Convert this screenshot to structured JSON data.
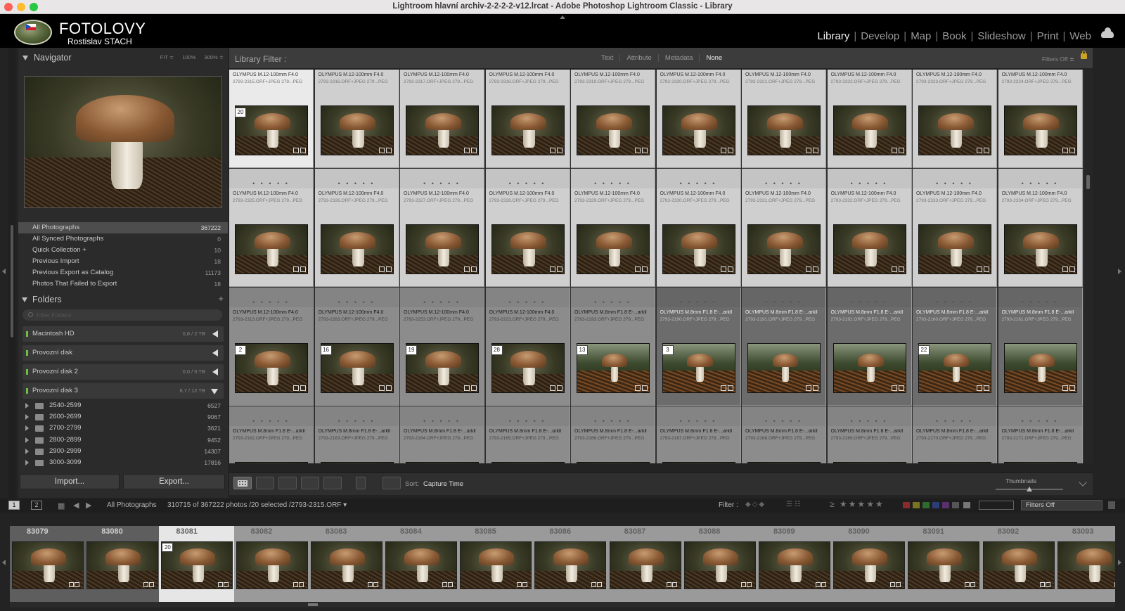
{
  "window": {
    "title": "Lightroom hlavní archiv-2-2-2-2-v12.lrcat - Adobe Photoshop Lightroom Classic - Library"
  },
  "identity": {
    "brand": "FOTOLOVY",
    "subtitle": "Rostislav STACH"
  },
  "modules": [
    "Library",
    "Develop",
    "Map",
    "Book",
    "Slideshow",
    "Print",
    "Web"
  ],
  "active_module": "Library",
  "navigator": {
    "title": "Navigator",
    "options": [
      "FIT ≑",
      "100%",
      "300% ≑"
    ]
  },
  "catalog": [
    {
      "label": "All Photographs",
      "count": "367222",
      "selected": true
    },
    {
      "label": "All Synced Photographs",
      "count": "0"
    },
    {
      "label": "Quick Collection  +",
      "count": "10"
    },
    {
      "label": "Previous Import",
      "count": "18"
    },
    {
      "label": "Previous Export as Catalog",
      "count": "11173"
    },
    {
      "label": "Photos That Failed to Export",
      "count": "18"
    }
  ],
  "folders": {
    "title": "Folders",
    "filter_placeholder": "Filter Folders",
    "volumes": [
      {
        "name": "Macintosh HD",
        "capacity": "0,8 / 2 TB"
      },
      {
        "name": "Provozní disk",
        "capacity": ""
      },
      {
        "name": "Provozní disk 2",
        "capacity": "0,0 / 5 TB"
      },
      {
        "name": "Provozní disk 3",
        "capacity": "6,7 / 12 TB"
      }
    ],
    "items": [
      {
        "name": "2540-2599",
        "count": "6527"
      },
      {
        "name": "2600-2699",
        "count": "9067"
      },
      {
        "name": "2700-2799",
        "count": "3621"
      },
      {
        "name": "2800-2899",
        "count": "9452"
      },
      {
        "name": "2900-2999",
        "count": "14307"
      },
      {
        "name": "3000-3099",
        "count": "17816"
      }
    ]
  },
  "buttons": {
    "import": "Import...",
    "export": "Export..."
  },
  "library_filter": {
    "label": "Library Filter :",
    "tabs": [
      "Text",
      "Attribute",
      "Metadata",
      "None"
    ],
    "active": "None",
    "filters_off": "Filters Off ≑"
  },
  "grid": {
    "rows": [
      {
        "cells": [
          {
            "l1": "OLYMPUS M.12-100mm F4.0",
            "l2": "2793-2315.ORF+JPEG    279...PEG",
            "vc": "20",
            "state": "sel"
          },
          {
            "l1": "OLYMPUS M.12-100mm F4.0",
            "l2": "2793-2316.ORF+JPEG    279...PEG"
          },
          {
            "l1": "OLYMPUS M.12-100mm F4.0",
            "l2": "2793-2317.ORF+JPEG    279...PEG"
          },
          {
            "l1": "OLYMPUS M.12-100mm F4.0",
            "l2": "2793-2318.ORF+JPEG    279...PEG"
          },
          {
            "l1": "OLYMPUS M.12-100mm F4.0",
            "l2": "2793-2319.ORF+JPEG    279...PEG"
          },
          {
            "l1": "OLYMPUS M.12-100mm F4.0",
            "l2": "2793-2320.ORF+JPEG    279...PEG"
          },
          {
            "l1": "OLYMPUS M.12-100mm F4.0",
            "l2": "2793-2321.ORF+JPEG    279...PEG"
          },
          {
            "l1": "OLYMPUS M.12-100mm F4.0",
            "l2": "2793-2322.ORF+JPEG    279...PEG"
          },
          {
            "l1": "OLYMPUS M.12-100mm F4.0",
            "l2": "2793-2323.ORF+JPEG    279...PEG"
          },
          {
            "l1": "OLYMPUS M.12-100mm F4.0",
            "l2": "2793-2324.ORF+JPEG    279...PEG"
          }
        ]
      },
      {
        "cells": [
          {
            "l1": "OLYMPUS M.12-100mm F4.0",
            "l2": "2793-2325.ORF+JPEG    279...PEG"
          },
          {
            "l1": "OLYMPUS M.12-100mm F4.0",
            "l2": "2793-2326.ORF+JPEG    279...PEG"
          },
          {
            "l1": "OLYMPUS M.12-100mm F4.0",
            "l2": "2793-2327.ORF+JPEG    279...PEG"
          },
          {
            "l1": "OLYMPUS M.12-100mm F4.0",
            "l2": "2793-2328.ORF+JPEG    279...PEG"
          },
          {
            "l1": "OLYMPUS M.12-100mm F4.0",
            "l2": "2793-2329.ORF+JPEG    279...PEG"
          },
          {
            "l1": "OLYMPUS M.12-100mm F4.0",
            "l2": "2793-2330.ORF+JPEG    279...PEG"
          },
          {
            "l1": "OLYMPUS M.12-100mm F4.0",
            "l2": "2793-2331.ORF+JPEG    279...PEG"
          },
          {
            "l1": "OLYMPUS M.12-100mm F4.0",
            "l2": "2793-2332.ORF+JPEG    279...PEG"
          },
          {
            "l1": "OLYMPUS M.12-100mm F4.0",
            "l2": "2793-2333.ORF+JPEG    279...PEG"
          },
          {
            "l1": "OLYMPUS M.12-100mm F4.0",
            "l2": "2793-2334.ORF+JPEG    279...PEG"
          }
        ]
      },
      {
        "cells": [
          {
            "l1": "OLYMPUS M.12-100mm F4.0",
            "l2": "2793-2313.ORF+JPEG    279...PEG",
            "vc": "2",
            "state": "dim"
          },
          {
            "l1": "OLYMPUS M.12-100mm F4.0",
            "l2": "2793-2283.ORF+JPEG    279...PEG",
            "vc": "16",
            "state": "dim"
          },
          {
            "l1": "OLYMPUS M.12-100mm F4.0",
            "l2": "2793-2253.ORF+JPEG    279...PEG",
            "vc": "19",
            "state": "dim"
          },
          {
            "l1": "OLYMPUS M.12-100mm F4.0",
            "l2": "2793-2223.ORF+JPEG    279...PEG",
            "vc": "28",
            "state": "dim"
          },
          {
            "l1": "OLYMPUS M.8mm F1.8    E-...arkll",
            "l2": "2793-2193.ORF+JPEG    279...PEG",
            "vc": "13",
            "state": "dim",
            "wide": true
          },
          {
            "l1": "OLYMPUS M.8mm F1.8    E-...arkll",
            "l2": "2793-2190.ORF+JPEG    279...PEG",
            "vc": "3",
            "state": "dark",
            "wide": true
          },
          {
            "l1": "OLYMPUS M.8mm F1.8    E-...arkll",
            "l2": "2793-2191.ORF+JPEG    279...PEG",
            "state": "dark",
            "wide": true
          },
          {
            "l1": "OLYMPUS M.8mm F1.8    E-...arkll",
            "l2": "2793-2192.ORF+JPEG    279...PEG",
            "state": "dark",
            "wide": true
          },
          {
            "l1": "OLYMPUS M.8mm F1.8    E-...arkll",
            "l2": "2793-2160.ORF+JPEG    279...PEG",
            "vc": "22",
            "state": "dark",
            "wide": true
          },
          {
            "l1": "OLYMPUS M.8mm F1.8    E-...arkll",
            "l2": "2793-2161.ORF+JPEG    279...PEG",
            "state": "dark",
            "wide": true
          }
        ]
      },
      {
        "cells": [
          {
            "l1": "OLYMPUS M.8mm F1.8    E-...arkll",
            "l2": "2793-2162.ORF+JPEG    279...PEG",
            "state": "dim"
          },
          {
            "l1": "OLYMPUS M.8mm F1.8    E-...arkll",
            "l2": "2793-2163.ORF+JPEG    279...PEG",
            "state": "dim"
          },
          {
            "l1": "OLYMPUS M.8mm F1.8    E-...arkll",
            "l2": "2793-2164.ORF+JPEG    279...PEG",
            "state": "dim"
          },
          {
            "l1": "OLYMPUS M.8mm F1.8    E-...arkll",
            "l2": "2793-2165.ORF+JPEG    279...PEG",
            "state": "dim"
          },
          {
            "l1": "OLYMPUS M.8mm F1.8    E-...arkll",
            "l2": "2793-2166.ORF+JPEG    279...PEG",
            "state": "dim"
          },
          {
            "l1": "OLYMPUS M.8mm F1.8    E-...arkll",
            "l2": "2793-2167.ORF+JPEG    279...PEG",
            "state": "dim"
          },
          {
            "l1": "OLYMPUS M.8mm F1.8    E-...arkll",
            "l2": "2793-2168.ORF+JPEG    279...PEG",
            "state": "dim"
          },
          {
            "l1": "OLYMPUS M.8mm F1.8    E-...arkll",
            "l2": "2793-2169.ORF+JPEG    279...PEG",
            "state": "dim"
          },
          {
            "l1": "OLYMPUS M.8mm F1.8    E-...arkll",
            "l2": "2793-2170.ORF+JPEG    279...PEG",
            "state": "dim"
          },
          {
            "l1": "OLYMPUS M.8mm F1.8    E-...arkll",
            "l2": "2793-2171.ORF+JPEG    279...PEG",
            "state": "dim"
          }
        ]
      }
    ]
  },
  "toolbar": {
    "sort_label": "Sort:",
    "sort_value": "Capture Time",
    "thumbnails_label": "Thumbnails"
  },
  "filmstrip_header": {
    "pages": [
      "1",
      "2"
    ],
    "source": "All Photographs",
    "info": "310715 of 367222 photos /20 selected /2793-2315.ORF ▾",
    "filter_label": "Filter :",
    "stars": "≥ ★★★★★",
    "filters_off": "Filters Off"
  },
  "filmstrip": [
    {
      "num": "83079",
      "state": "dark"
    },
    {
      "num": "83080",
      "state": "dark"
    },
    {
      "num": "83081",
      "state": "sel",
      "vc": "20"
    },
    {
      "num": "83082"
    },
    {
      "num": "83083"
    },
    {
      "num": "83084"
    },
    {
      "num": "83085"
    },
    {
      "num": "83086"
    },
    {
      "num": "83087"
    },
    {
      "num": "83088"
    },
    {
      "num": "83089"
    },
    {
      "num": "83090"
    },
    {
      "num": "83091"
    },
    {
      "num": "83092"
    },
    {
      "num": "83093"
    }
  ],
  "colors": {
    "label_red": "#8a2a2a",
    "label_yellow": "#7a7420",
    "label_green": "#2f6a2f",
    "label_blue": "#2a3d78",
    "label_purple": "#5a2f6e"
  }
}
